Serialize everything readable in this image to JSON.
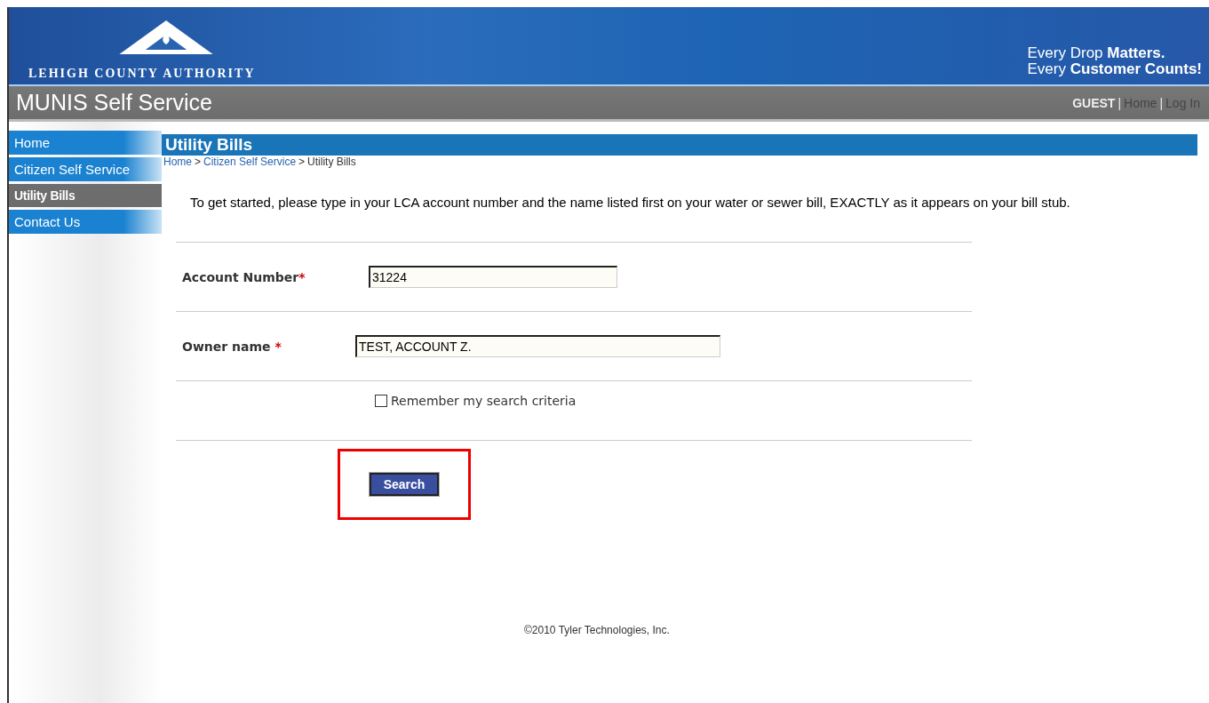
{
  "banner": {
    "org_name": "LEHIGH COUNTY AUTHORITY",
    "tagline": [
      "Every Drop **Matters.**",
      "Every **Customer Counts!**"
    ]
  },
  "title_bar": {
    "title": "MUNIS Self Service",
    "user": "GUEST",
    "separator": "|",
    "links": [
      "Home",
      "Log In"
    ]
  },
  "sidebar": {
    "items": [
      {
        "label": "Home",
        "selected": false
      },
      {
        "label": "Citizen Self Service",
        "selected": false
      },
      {
        "label": "Utility Bills",
        "selected": true
      },
      {
        "label": "Contact Us",
        "selected": false
      }
    ]
  },
  "page": {
    "heading": "Utility Bills",
    "breadcrumb": [
      "Home",
      "Citizen Self Service"
    ],
    "breadcrumb_current": "Utility Bills",
    "breadcrumb_separator": ">",
    "intro": "To get started, please type in your LCA account number and the name listed first on your water or sewer bill, EXACTLY as it appears on your bill stub.",
    "fields": [
      {
        "label": "Account Number",
        "required_mark": "*",
        "value": "31224"
      },
      {
        "label": "Owner name",
        "required_mark": " *",
        "value": "TEST, ACCOUNT Z."
      }
    ],
    "remember": {
      "label": "Remember my search criteria",
      "checked": false
    },
    "search_button": {
      "label": "Search",
      "highlighted": true
    }
  },
  "footer": "©2010 Tyler Technologies, Inc."
}
